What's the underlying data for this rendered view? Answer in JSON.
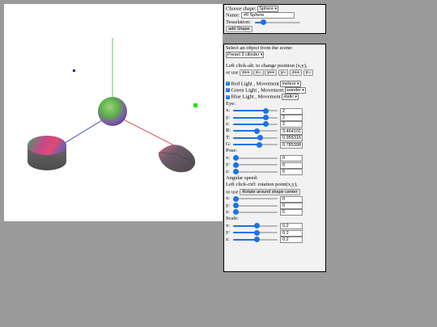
{
  "add_panel": {
    "choose_shape_label": "Choose shape:",
    "shape_selected": "Sphere",
    "name_label": "Name:",
    "name_value": "#0 Sphere",
    "tesselation_label": "Tesselation:",
    "tesselation_level": 0.15,
    "add_button": "add Shape"
  },
  "object_panel": {
    "select_label": "Select an object from the scene:",
    "object_selected": "Preset 3 cilinder",
    "left_click_alt": "Left click-alt: to change position (x,y),",
    "or_use": "or use",
    "move_buttons": [
      "x++",
      "x--",
      "y++",
      "y--",
      "z++",
      "z--"
    ],
    "lights": [
      {
        "label": "Red   Light , Movement",
        "checked": true,
        "movement": "meteor"
      },
      {
        "label": "Green Light , Movement",
        "checked": true,
        "movement": "wander"
      },
      {
        "label": "Blue  Light , Movement",
        "checked": true,
        "movement": "static"
      }
    ],
    "eye_label": "Eye:",
    "eye": [
      {
        "label": "x:",
        "value": "2",
        "level": 0.78
      },
      {
        "label": "y:",
        "value": "2",
        "level": 0.78
      },
      {
        "label": "z:",
        "value": "2",
        "level": 0.78
      },
      {
        "label": "R:",
        "value": "3.464101",
        "level": 0.55
      },
      {
        "label": "T:",
        "value": "0.955316",
        "level": 0.62
      },
      {
        "label": "G:",
        "value": "0.785398",
        "level": 0.6
      }
    ],
    "pose_label": "Pose:",
    "pose": [
      {
        "label": "x:",
        "value": "0",
        "level": 0.0
      },
      {
        "label": "y:",
        "value": "0",
        "level": 0.0
      },
      {
        "label": "z:",
        "value": "0",
        "level": 0.0
      }
    ],
    "angular_label": "Angular speed:",
    "left_click_ctrl": "Left click-ctrl: rotation point(x,y),",
    "or_use2": "or use",
    "rotate_button": "Rotate around shape center",
    "angular": [
      {
        "label": "x:",
        "value": "0",
        "level": 0.0
      },
      {
        "label": "y:",
        "value": "0",
        "level": 0.0
      },
      {
        "label": "z:",
        "value": "0",
        "level": 0.0
      }
    ],
    "scale_label": "Scale:",
    "scale": [
      {
        "label": "x:",
        "value": "0.2",
        "level": 0.55
      },
      {
        "label": "y:",
        "value": "0.2",
        "level": 0.55
      },
      {
        "label": "z:",
        "value": "0.2",
        "level": 0.55
      }
    ]
  }
}
